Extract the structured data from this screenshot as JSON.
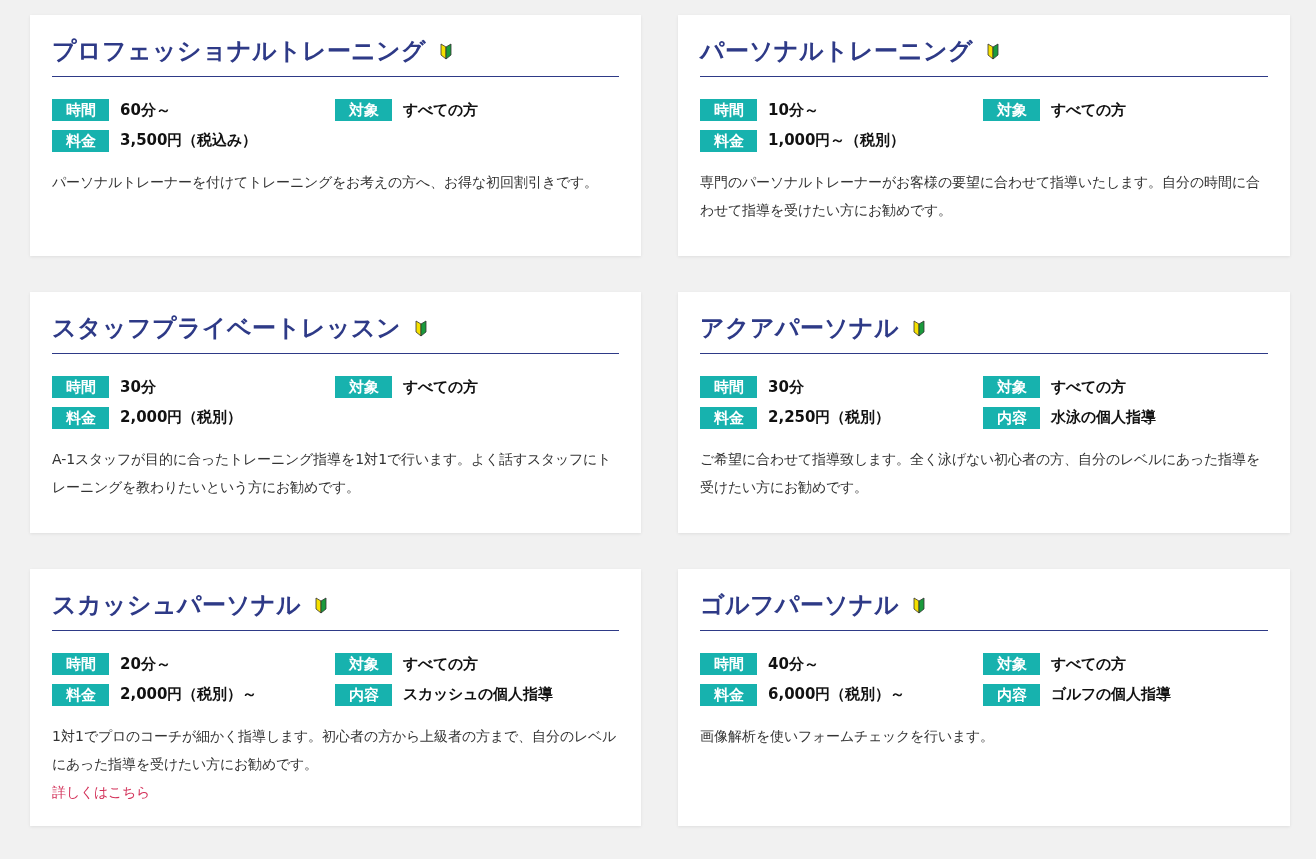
{
  "courses": [
    {
      "title": "プロフェッショナルトレーニング",
      "specs": [
        {
          "label": "時間",
          "value": "60分～"
        },
        {
          "label": "対象",
          "value": "すべての方"
        },
        {
          "label": "料金",
          "value": "3,500円（税込み）"
        }
      ],
      "description": "パーソナルトレーナーを付けてトレーニングをお考えの方へ、お得な初回割引きです。"
    },
    {
      "title": "パーソナルトレーニング",
      "specs": [
        {
          "label": "時間",
          "value": "10分～"
        },
        {
          "label": "対象",
          "value": "すべての方"
        },
        {
          "label": "料金",
          "value": "1,000円～（税別）"
        }
      ],
      "description": "専門のパーソナルトレーナーがお客様の要望に合わせて指導いたします。自分の時間に合わせて指導を受けたい方にお勧めです。"
    },
    {
      "title": "スタッフプライベートレッスン",
      "specs": [
        {
          "label": "時間",
          "value": "30分"
        },
        {
          "label": "対象",
          "value": "すべての方"
        },
        {
          "label": "料金",
          "value": "2,000円（税別）"
        }
      ],
      "description": "A-1スタッフが目的に合ったトレーニング指導を1対1で行います。よく話すスタッフにトレーニングを教わりたいという方にお勧めです。"
    },
    {
      "title": "アクアパーソナル",
      "specs": [
        {
          "label": "時間",
          "value": "30分"
        },
        {
          "label": "対象",
          "value": "すべての方"
        },
        {
          "label": "料金",
          "value": "2,250円（税別）"
        },
        {
          "label": "内容",
          "value": "水泳の個人指導"
        }
      ],
      "description": "ご希望に合わせて指導致します。全く泳げない初心者の方、自分のレベルにあった指導を受けたい方にお勧めです。"
    },
    {
      "title": "スカッシュパーソナル",
      "specs": [
        {
          "label": "時間",
          "value": "20分～"
        },
        {
          "label": "対象",
          "value": "すべての方"
        },
        {
          "label": "料金",
          "value": "2,000円（税別）～"
        },
        {
          "label": "内容",
          "value": "スカッシュの個人指導"
        }
      ],
      "description": "1対1でプロのコーチが細かく指導します。初心者の方から上級者の方まで、自分のレベルにあった指導を受けたい方にお勧めです。",
      "link": "詳しくはこちら"
    },
    {
      "title": "ゴルフパーソナル",
      "specs": [
        {
          "label": "時間",
          "value": "40分～"
        },
        {
          "label": "対象",
          "value": "すべての方"
        },
        {
          "label": "料金",
          "value": "6,000円（税別）～"
        },
        {
          "label": "内容",
          "value": "ゴルフの個人指導"
        }
      ],
      "description": "画像解析を使いフォームチェックを行います。"
    }
  ]
}
